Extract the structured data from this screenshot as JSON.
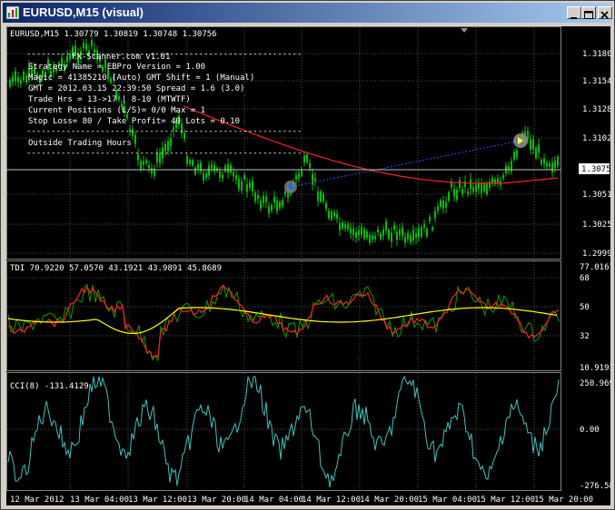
{
  "window": {
    "title": "EURUSD,M15 (visual)"
  },
  "main_pane": {
    "header": "EURUSD,M15  1.30779 1.30819 1.30748 1.30756",
    "current_price": "1.30756",
    "price_ticks": [
      "1.31800",
      "1.31545",
      "1.31285",
      "1.31025",
      "1.30510",
      "1.30250",
      "1.29990"
    ],
    "info_lines": [
      "FX-Scanner.com v1.01",
      "Strategy Name = EBPro  Version = 1.00",
      "Magic = 41385210 (Auto)   GMT Shift = 1 (Manual)",
      "GMT = 2012.03.15 22:39:50  Spread = 1.6 (3.0)",
      "Trade Hrs = 13->17  |  8-10 (MTWTF)",
      "Current Positions (L/S)= 0/0   Max = 1",
      "Stop Loss= 80 / Take Profit= 40   Lots = 0.10",
      "Outside Trading Hours"
    ],
    "separator": "--------------------------------------------------------"
  },
  "tdi_pane": {
    "header": "TDI 70.9220 57.0570 43.1921 43.9891 45.8689",
    "ticks": [
      "77.0167",
      "68",
      "50",
      "32",
      "10.9193"
    ]
  },
  "cci_pane": {
    "header": "CCI(8) -131.4129",
    "ticks": [
      "250.9690",
      "0.00",
      "-276.5804"
    ]
  },
  "time_axis": [
    "12 Mar 2012",
    "13 Mar 04:00",
    "13 Mar 12:00",
    "13 Mar 20:00",
    "14 Mar 04:00",
    "14 Mar 12:00",
    "14 Mar 20:00",
    "15 Mar 04:00",
    "15 Mar 12:00",
    "15 Mar 20:00"
  ],
  "colors": {
    "candles": "#00c000",
    "moving_average": "#ff2020",
    "tdi_red": "#ff2020",
    "tdi_green": "#00a000",
    "tdi_yellow": "#ffff00",
    "cci": "#40c0c0",
    "grid": "#505050",
    "price_tag_bg": "#ffffff"
  },
  "icons": {
    "app": "mt4-chart-icon",
    "minimize": "minimize-icon",
    "maximize": "maximize-icon",
    "close": "close-icon"
  }
}
